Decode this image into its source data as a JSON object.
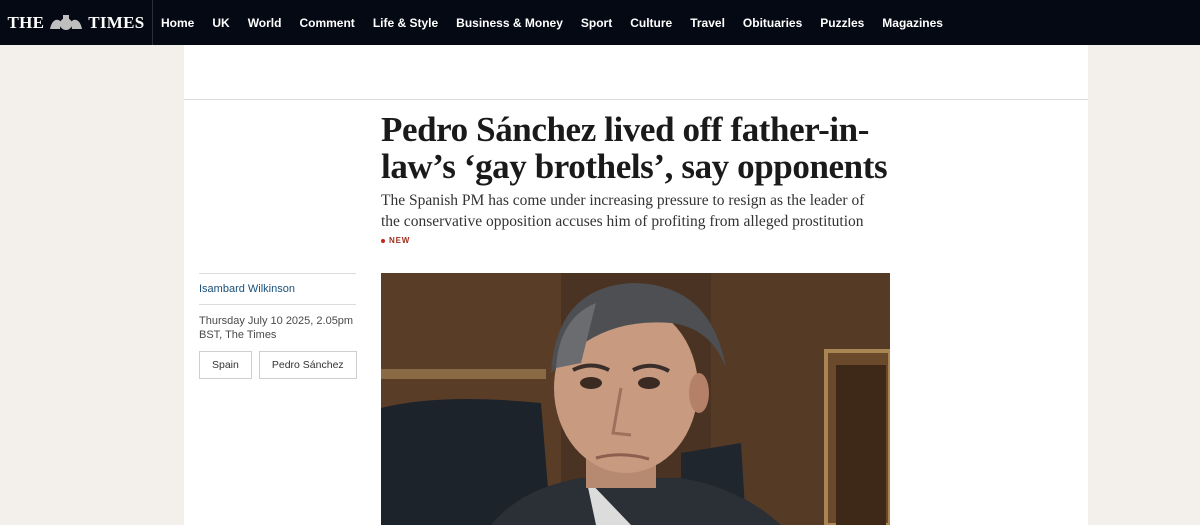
{
  "header": {
    "logo": {
      "left": "THE",
      "right": "TIMES"
    },
    "nav": [
      "Home",
      "UK",
      "World",
      "Comment",
      "Life & Style",
      "Business & Money",
      "Sport",
      "Culture",
      "Travel",
      "Obituaries",
      "Puzzles",
      "Magazines"
    ]
  },
  "article": {
    "headline": "Pedro Sánchez lived off father-in-law’s ‘gay brothels’, say opponents",
    "standfirst": "The Spanish PM has come under increasing pressure to resign as the leader of the conservative opposition accuses him of profiting from alleged prostitution",
    "badge": "NEW",
    "author": "Isambard Wilkinson",
    "dateline": "Thursday July 10 2025, 2.05pm BST, The Times",
    "tags": [
      "Spain",
      "Pedro Sánchez"
    ]
  },
  "colors": {
    "nav_bg": "#050914",
    "page_bg": "#f3efea",
    "author_link": "#19507a",
    "badge": "#a02e1c"
  }
}
